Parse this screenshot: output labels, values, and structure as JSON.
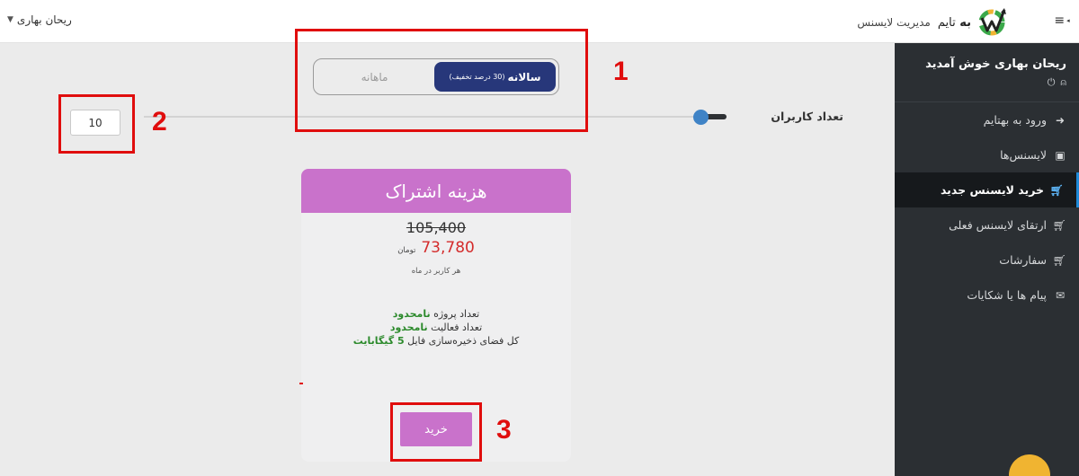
{
  "header": {
    "user_menu_label": "ریحان بهاری",
    "brand_name_bold": "به",
    "brand_name_rest": "تایم",
    "brand_subtitle": "مدیریت لایسنس"
  },
  "sidebar": {
    "welcome": "ریحان بهاری خوش آمدید",
    "items": [
      {
        "label": "ورود به بهتایم",
        "icon": "sign-in-icon"
      },
      {
        "label": "لایسنس‌ها",
        "icon": "id-card-icon"
      },
      {
        "label": "خرید لایسنس جدید",
        "icon": "cart-icon"
      },
      {
        "label": "ارتقای لایسنس فعلی",
        "icon": "cart-up-icon"
      },
      {
        "label": "سفارشات",
        "icon": "cart-icon"
      },
      {
        "label": "پیام ها یا شکایات",
        "icon": "envelope-icon"
      }
    ],
    "active_index": 2
  },
  "billing": {
    "yearly_label": "سالانه",
    "yearly_discount": "(30 درصد تخفیف)",
    "monthly_label": "ماهانه",
    "selected": "yearly"
  },
  "users": {
    "label": "تعداد کاربران",
    "value": "10"
  },
  "card": {
    "title": "هزینه اشتراک",
    "old_price": "105,400",
    "new_price": "73,780",
    "currency": "تومان",
    "per_user": "هر کاربر در ماه",
    "features": [
      {
        "text": "تعداد پروژه",
        "value": "نامحدود"
      },
      {
        "text": "تعداد فعالیت",
        "value": "نامحدود"
      },
      {
        "text": "کل فضای ذخیره‌سازی فایل",
        "value": "5 گیگابایت"
      }
    ],
    "buy_label": "خرید"
  },
  "annotations": {
    "one": "1",
    "two": "2",
    "three": "3"
  },
  "colors": {
    "sidebar_bg": "#2b2f33",
    "toggle_active": "#27377a",
    "card_accent": "#c972cb",
    "price_red": "#d42b2b",
    "feature_green": "#2c8a2c",
    "annotation_red": "#e00d0d"
  }
}
